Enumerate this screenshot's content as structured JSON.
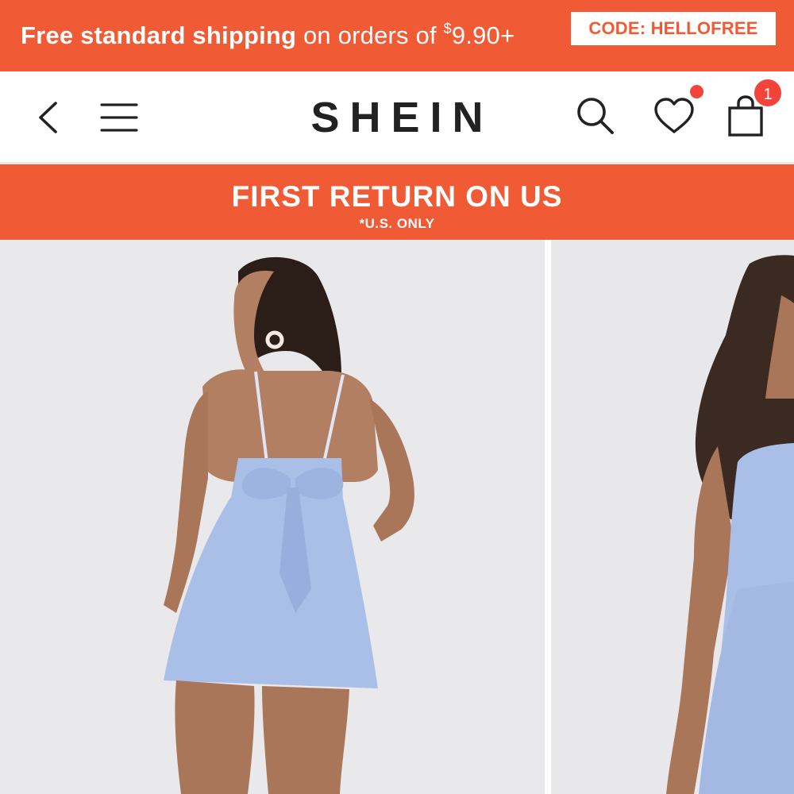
{
  "shipping_banner": {
    "text_bold": "Free standard shipping",
    "text_rest": " on orders of ",
    "currency": "$",
    "amount": "9.90+",
    "code": "CODE: HELLOFREE"
  },
  "header": {
    "logo": "SHEIN",
    "cart_count": "1"
  },
  "promo_banner": {
    "title": "FIRST RETURN ON US",
    "subtitle": "*U.S. ONLY"
  },
  "colors": {
    "brand_orange": "#f05a35",
    "badge_red": "#f2443a",
    "dress_blue": "#a9bfe8"
  },
  "icons": [
    "back-arrow-icon",
    "menu-icon",
    "search-icon",
    "heart-icon",
    "shopping-bag-icon"
  ]
}
